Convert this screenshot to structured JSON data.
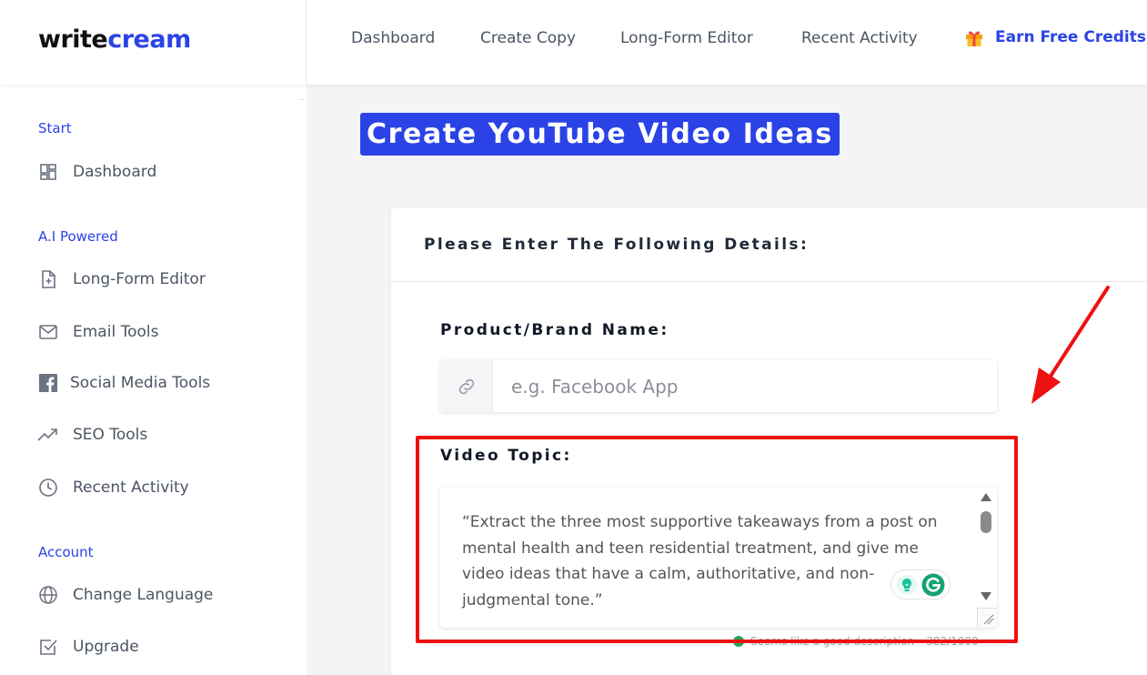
{
  "brand": {
    "part1": "write",
    "part2": "cream"
  },
  "topnav": {
    "items": [
      "Dashboard",
      "Create Copy",
      "Long-Form Editor",
      "Recent Activity"
    ],
    "earn": {
      "label": "Earn Free Credits",
      "icon": "gift-icon"
    }
  },
  "sidebar": {
    "sections": [
      "Start",
      "A.I Powered",
      "Account"
    ],
    "items": [
      {
        "label": "Dashboard",
        "icon": "dashboard-icon"
      },
      {
        "label": "Long-Form Editor",
        "icon": "document-plus-icon"
      },
      {
        "label": "Email Tools",
        "icon": "envelope-icon"
      },
      {
        "label": "Social Media Tools",
        "icon": "facebook-icon"
      },
      {
        "label": "SEO Tools",
        "icon": "trending-icon"
      },
      {
        "label": "Recent Activity",
        "icon": "clock-icon"
      },
      {
        "label": "Change Language",
        "icon": "globe-icon"
      },
      {
        "label": "Upgrade",
        "icon": "checkbox-icon"
      }
    ]
  },
  "page": {
    "title": "Create YouTube Video Ideas"
  },
  "form": {
    "header": "Please Enter The Following Details:",
    "brand_label": "Product/Brand Name:",
    "brand_placeholder": "e.g. Facebook App",
    "topic_label": "Video Topic:",
    "topic_value": "“Extract the three most supportive takeaways from a post on mental health and teen residential treatment, and give me video ideas that have a calm, authoritative, and non-judgmental tone.”",
    "helper_text": "Seems like a good description",
    "char_count": "382/1000"
  },
  "colors": {
    "accent": "#2b43e6",
    "highlight": "#ee1111",
    "success": "#22a65a"
  }
}
